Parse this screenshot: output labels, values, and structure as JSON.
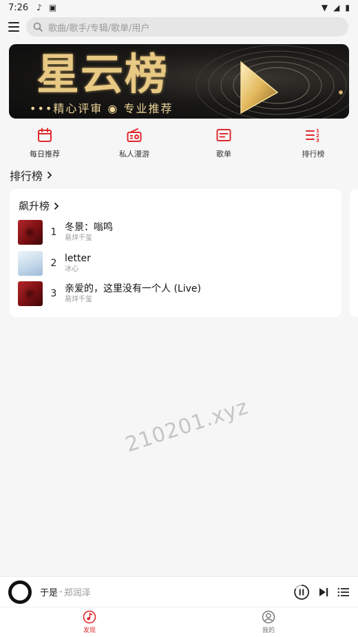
{
  "status_bar": {
    "time": "7:26",
    "icons_left": [
      "music-note-icon",
      "image-icon"
    ],
    "icons_right": [
      "wifi-icon",
      "signal-icon",
      "battery-icon"
    ]
  },
  "search": {
    "placeholder": "歌曲/歌手/专辑/歌单/用户"
  },
  "banner": {
    "title": "星云榜",
    "subtitle": "•••精心评审 ◉ 专业推荐"
  },
  "quick_actions": [
    {
      "label": "每日推荐",
      "icon": "calendar-icon"
    },
    {
      "label": "私人漫游",
      "icon": "radio-icon"
    },
    {
      "label": "歌单",
      "icon": "playlist-icon"
    },
    {
      "label": "排行榜",
      "icon": "ranking-icon"
    }
  ],
  "section": {
    "title": "排行榜"
  },
  "chart_card": {
    "title": "飙升榜",
    "songs": [
      {
        "rank": "1",
        "title": "冬景：嗡鸣",
        "artist": "易烊千玺"
      },
      {
        "rank": "2",
        "title": "letter",
        "artist": "冰心"
      },
      {
        "rank": "3",
        "title": "亲爱的，这里没有一个人 (Live)",
        "artist": "易烊千玺"
      }
    ]
  },
  "watermark": "210201.xyz",
  "now_playing": {
    "title": "于是",
    "separator": "-",
    "artist": "郑润泽"
  },
  "tabs": [
    {
      "label": "发现",
      "active": true
    },
    {
      "label": "我的",
      "active": false
    }
  ],
  "colors": {
    "accent": "#e0282c",
    "background": "#f6f6f6",
    "banner_gold": "#e8c984"
  }
}
